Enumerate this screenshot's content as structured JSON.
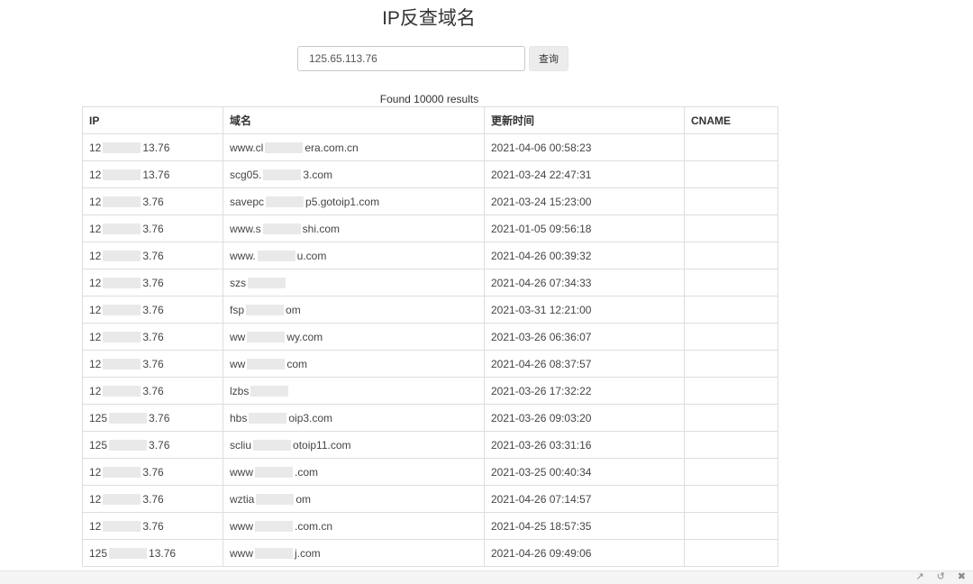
{
  "page": {
    "title": "IP反查域名"
  },
  "search": {
    "value": "125.65.113.76",
    "button_label": "查询"
  },
  "results": {
    "summary": "Found 10000 results",
    "columns": [
      "IP",
      "域名",
      "更新时间",
      "CNAME"
    ],
    "rows": [
      {
        "ip_start": "12",
        "ip_end": "13.76",
        "domain_start": "www.cl",
        "domain_end": "era.com.cn",
        "time": "2021-04-06 00:58:23",
        "cname": ""
      },
      {
        "ip_start": "12",
        "ip_end": "13.76",
        "domain_start": "scg05.",
        "domain_end": "3.com",
        "time": "2021-03-24 22:47:31",
        "cname": ""
      },
      {
        "ip_start": "12",
        "ip_end": "3.76",
        "domain_start": "savepc",
        "domain_end": "p5.gotoip1.com",
        "time": "2021-03-24 15:23:00",
        "cname": ""
      },
      {
        "ip_start": "12",
        "ip_end": "3.76",
        "domain_start": "www.s",
        "domain_end": "shi.com",
        "time": "2021-01-05 09:56:18",
        "cname": ""
      },
      {
        "ip_start": "12",
        "ip_end": "3.76",
        "domain_start": "www.",
        "domain_end": "u.com",
        "time": "2021-04-26 00:39:32",
        "cname": ""
      },
      {
        "ip_start": "12",
        "ip_end": "3.76",
        "domain_start": "szs",
        "domain_end": "",
        "time": "2021-04-26 07:34:33",
        "cname": ""
      },
      {
        "ip_start": "12",
        "ip_end": "3.76",
        "domain_start": "fsp",
        "domain_end": "om",
        "time": "2021-03-31 12:21:00",
        "cname": ""
      },
      {
        "ip_start": "12",
        "ip_end": "3.76",
        "domain_start": "ww",
        "domain_end": "wy.com",
        "time": "2021-03-26 06:36:07",
        "cname": ""
      },
      {
        "ip_start": "12",
        "ip_end": "3.76",
        "domain_start": "ww",
        "domain_end": "com",
        "time": "2021-04-26 08:37:57",
        "cname": ""
      },
      {
        "ip_start": "12",
        "ip_end": "3.76",
        "domain_start": "lzbs",
        "domain_end": "",
        "time": "2021-03-26 17:32:22",
        "cname": ""
      },
      {
        "ip_start": "125",
        "ip_end": "3.76",
        "domain_start": "hbs",
        "domain_end": "oip3.com",
        "time": "2021-03-26 09:03:20",
        "cname": ""
      },
      {
        "ip_start": "125",
        "ip_end": "3.76",
        "domain_start": "scliu",
        "domain_end": "otoip11.com",
        "time": "2021-03-26 03:31:16",
        "cname": ""
      },
      {
        "ip_start": "12",
        "ip_end": "3.76",
        "domain_start": "www",
        "domain_end": ".com",
        "time": "2021-03-25 00:40:34",
        "cname": ""
      },
      {
        "ip_start": "12",
        "ip_end": "3.76",
        "domain_start": "wztia",
        "domain_end": "om",
        "time": "2021-04-26 07:14:57",
        "cname": ""
      },
      {
        "ip_start": "12",
        "ip_end": "3.76",
        "domain_start": "www",
        "domain_end": ".com.cn",
        "time": "2021-04-25 18:57:35",
        "cname": ""
      },
      {
        "ip_start": "125",
        "ip_end": "13.76",
        "domain_start": "www",
        "domain_end": "j.com",
        "time": "2021-04-26 09:49:06",
        "cname": ""
      }
    ]
  },
  "footer": {
    "icons": [
      "share-icon",
      "history-icon",
      "delete-icon"
    ]
  }
}
